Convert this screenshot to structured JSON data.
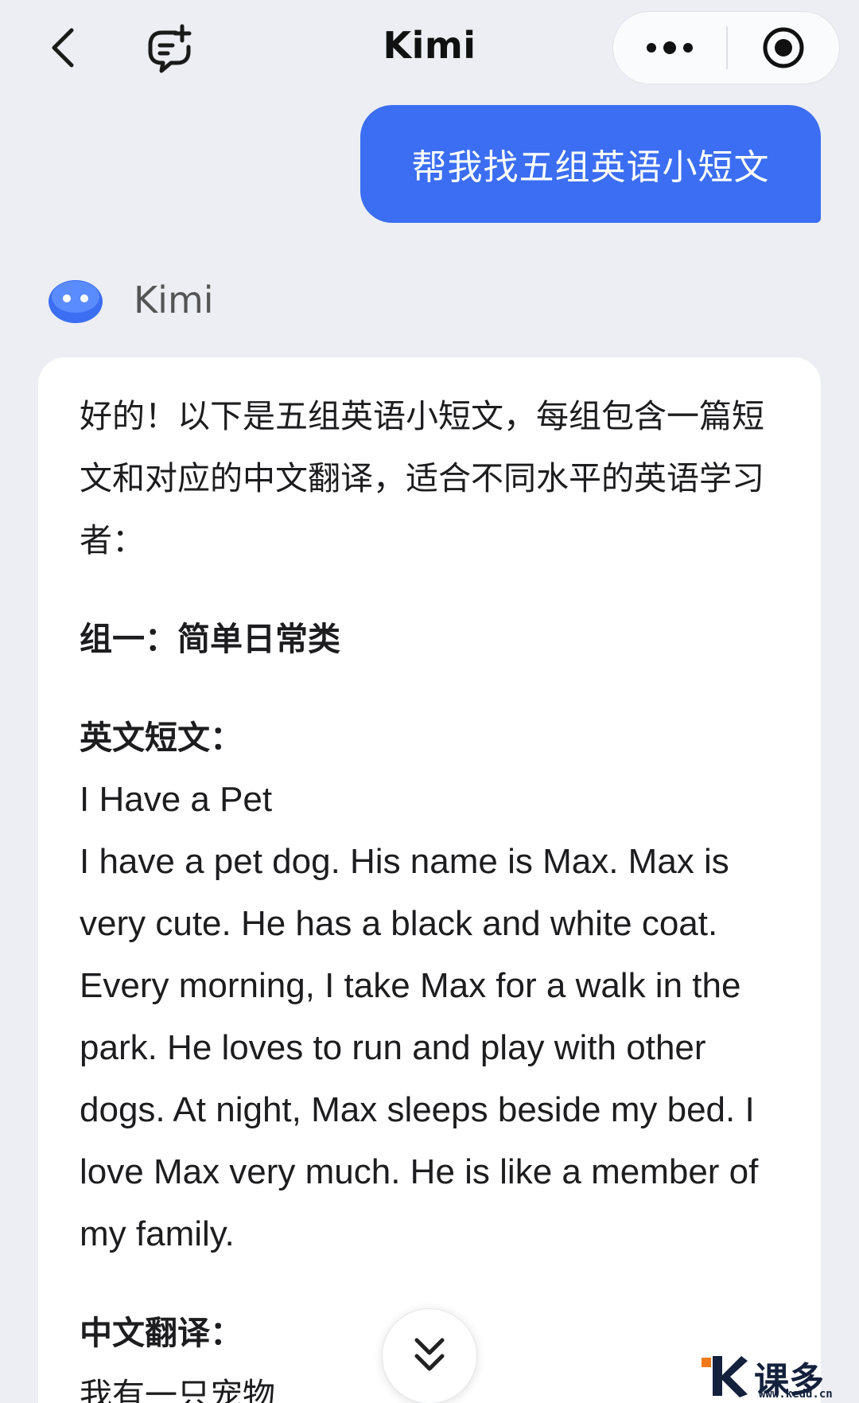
{
  "header": {
    "title": "Kimi",
    "back_icon": "chevron-left-icon",
    "new_chat_icon": "new-chat-icon",
    "more_icon": "more-dots-icon",
    "record_icon": "record-target-icon"
  },
  "user_message": {
    "text": "帮我找五组英语小短文",
    "bubble_color": "#3b6ef2"
  },
  "assistant": {
    "name": "Kimi",
    "avatar_color": "#3b6ef2",
    "intro": "好的！以下是五组英语小短文，每组包含一篇短文和对应的中文翻译，适合不同水平的英语学习者：",
    "group_title": "组一：简单日常类",
    "english_label": "英文短文：",
    "english_title": "I Have a Pet",
    "english_text": "I have a pet dog. His name is Max. Max is very cute. He has a black and white coat. Every morning, I take Max for a walk in the park. He loves to run and play with other dogs. At night, Max sleeps beside my bed. I love Max very much. He is like a member of my family.",
    "chinese_label": "中文翻译：",
    "chinese_first_line": "我有一只宠物"
  },
  "scroll_button": {
    "icon": "double-chevron-down-icon"
  },
  "watermark": {
    "text": "课多多",
    "url": "www.kedd.cn"
  }
}
